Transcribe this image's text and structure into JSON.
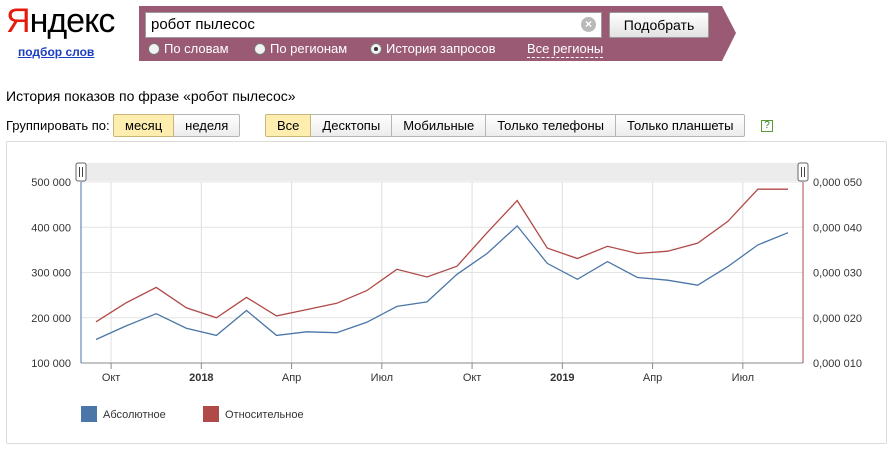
{
  "logo": {
    "first": "Я",
    "rest": "ндекс",
    "sub": "подбор слов"
  },
  "search": {
    "query": "робот пылесос",
    "clear": "×",
    "submit": "Подобрать"
  },
  "modes": {
    "by_words": "По словам",
    "by_regions": "По регионам",
    "history": "История запросов",
    "selected": "История запросов",
    "all_regions": "Все регионы"
  },
  "page_title": "История показов по фразе «робот пылесос»",
  "grouping": {
    "label": "Группировать по:",
    "month": "месяц",
    "week": "неделя",
    "selected": "месяц"
  },
  "devices": {
    "all": "Все",
    "desktops": "Десктопы",
    "mobile": "Мобильные",
    "phones": "Только телефоны",
    "tablets": "Только планшеты",
    "selected": "Все"
  },
  "help": "?",
  "colors": {
    "brand_red": "#e31c0d",
    "panel": "#9a5a73",
    "absolute": "#4a76a8",
    "relative": "#b04a48"
  },
  "chart_data": {
    "type": "line",
    "x": [
      "2017-09",
      "2017-10",
      "2017-11",
      "2017-12",
      "2018-01",
      "2018-02",
      "2018-03",
      "2018-04",
      "2018-05",
      "2018-06",
      "2018-07",
      "2018-08",
      "2018-09",
      "2018-10",
      "2018-11",
      "2018-12",
      "2019-01",
      "2019-02",
      "2019-03",
      "2019-04",
      "2019-05",
      "2019-06",
      "2019-07",
      "2019-08",
      "2019-09"
    ],
    "x_tick_labels": [
      "Окт",
      "2018",
      "Апр",
      "Июл",
      "Окт",
      "2019",
      "Апр",
      "Июл"
    ],
    "series": [
      {
        "name": "Абсолютное",
        "axis": "left",
        "values": [
          152000,
          182000,
          209000,
          177000,
          161000,
          216000,
          161000,
          169000,
          167000,
          190000,
          225000,
          235000,
          296000,
          342000,
          403000,
          320000,
          285000,
          324000,
          289000,
          283000,
          272000,
          313000,
          361000,
          388000
        ]
      },
      {
        "name": "Относительное",
        "axis": "right",
        "values": [
          0.0191,
          0.0233,
          0.0267,
          0.0222,
          0.02,
          0.0245,
          0.0204,
          0.0218,
          0.0232,
          0.026,
          0.0307,
          0.029,
          0.0314,
          0.0388,
          0.0459,
          0.0354,
          0.0331,
          0.0358,
          0.0342,
          0.0347,
          0.0365,
          0.0413,
          0.0484,
          0.0484
        ]
      }
    ],
    "y_left": {
      "ylim": [
        100000,
        500000
      ],
      "ticks": [
        "100 000",
        "200 000",
        "300 000",
        "400 000",
        "500 000"
      ]
    },
    "y_right": {
      "ylim": [
        0.01,
        0.05
      ],
      "ticks": [
        "0,000 010",
        "0,000 020",
        "0,000 030",
        "0,000 040",
        "0,000 050"
      ]
    },
    "legend": [
      "Абсолютное",
      "Относительное"
    ],
    "legend_position": "bottom-left",
    "grid": true
  }
}
